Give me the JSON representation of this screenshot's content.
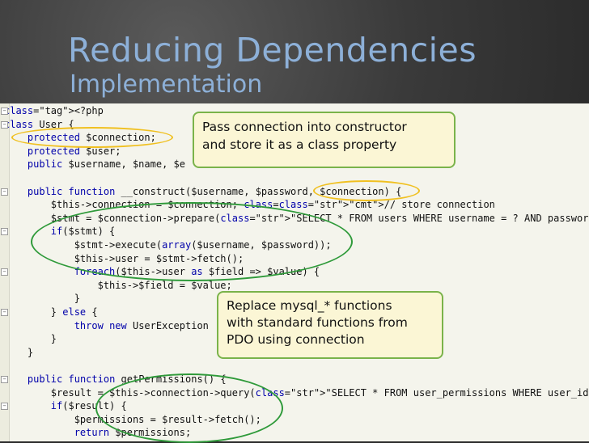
{
  "slide": {
    "title": "Reducing Dependencies",
    "subtitle": "Implementation"
  },
  "code": {
    "lines": [
      "<?php",
      "class User {",
      "    protected $connection;",
      "    protected $user;",
      "    public $username, $name, $e",
      "",
      "    public function __construct($username, $password, $connection) {",
      "        $this->connection = $connection; // store connection",
      "        $stmt = $connection->prepare(\"SELECT * FROM users WHERE username = ? AND password = ?\");",
      "        if($stmt) {",
      "            $stmt->execute(array($username, $password));",
      "            $this->user = $stmt->fetch();",
      "            foreach($this->user as $field => $value) {",
      "                $this->$field = $value;",
      "            }",
      "        } else {",
      "            throw new UserException",
      "        }",
      "    }",
      "",
      "    public function getPermissions() {",
      "        $result = $this->connection->query(\"SELECT * FROM user_permissions WHERE user_id = '\".(",
      "        if($result) {",
      "            $permissions = $result->fetch();",
      "            return $permissions;"
    ]
  },
  "callouts": [
    {
      "text_line1": "Pass connection into constructor",
      "text_line2": "and store it as a class property"
    },
    {
      "text_line1": "Replace mysql_* functions",
      "text_line2": "with standard functions from",
      "text_line3": "PDO using connection"
    }
  ],
  "colors": {
    "title": "#8db0d8",
    "callout_border": "#7ab34a",
    "callout_bg": "#fbf6d5",
    "highlight_yellow": "#f0c020",
    "highlight_green": "#2f9a3a"
  }
}
